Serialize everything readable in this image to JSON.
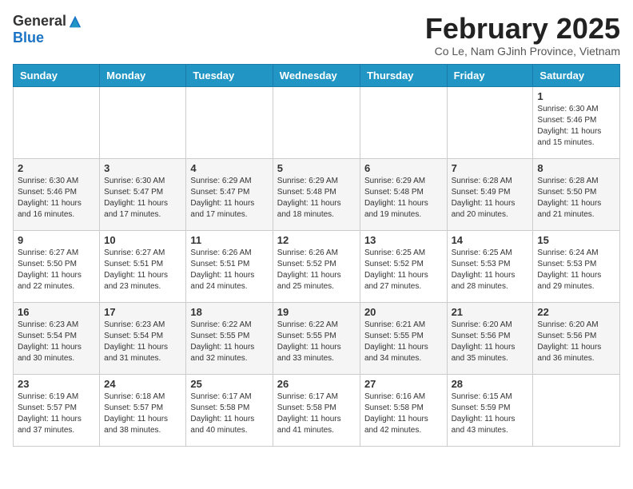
{
  "header": {
    "logo_general": "General",
    "logo_blue": "Blue",
    "month_title": "February 2025",
    "subtitle": "Co Le, Nam GJinh Province, Vietnam"
  },
  "days_of_week": [
    "Sunday",
    "Monday",
    "Tuesday",
    "Wednesday",
    "Thursday",
    "Friday",
    "Saturday"
  ],
  "weeks": [
    [
      {
        "day": "",
        "info": ""
      },
      {
        "day": "",
        "info": ""
      },
      {
        "day": "",
        "info": ""
      },
      {
        "day": "",
        "info": ""
      },
      {
        "day": "",
        "info": ""
      },
      {
        "day": "",
        "info": ""
      },
      {
        "day": "1",
        "info": "Sunrise: 6:30 AM\nSunset: 5:46 PM\nDaylight: 11 hours\nand 15 minutes."
      }
    ],
    [
      {
        "day": "2",
        "info": "Sunrise: 6:30 AM\nSunset: 5:46 PM\nDaylight: 11 hours\nand 16 minutes."
      },
      {
        "day": "3",
        "info": "Sunrise: 6:30 AM\nSunset: 5:47 PM\nDaylight: 11 hours\nand 17 minutes."
      },
      {
        "day": "4",
        "info": "Sunrise: 6:29 AM\nSunset: 5:47 PM\nDaylight: 11 hours\nand 17 minutes."
      },
      {
        "day": "5",
        "info": "Sunrise: 6:29 AM\nSunset: 5:48 PM\nDaylight: 11 hours\nand 18 minutes."
      },
      {
        "day": "6",
        "info": "Sunrise: 6:29 AM\nSunset: 5:48 PM\nDaylight: 11 hours\nand 19 minutes."
      },
      {
        "day": "7",
        "info": "Sunrise: 6:28 AM\nSunset: 5:49 PM\nDaylight: 11 hours\nand 20 minutes."
      },
      {
        "day": "8",
        "info": "Sunrise: 6:28 AM\nSunset: 5:50 PM\nDaylight: 11 hours\nand 21 minutes."
      }
    ],
    [
      {
        "day": "9",
        "info": "Sunrise: 6:27 AM\nSunset: 5:50 PM\nDaylight: 11 hours\nand 22 minutes."
      },
      {
        "day": "10",
        "info": "Sunrise: 6:27 AM\nSunset: 5:51 PM\nDaylight: 11 hours\nand 23 minutes."
      },
      {
        "day": "11",
        "info": "Sunrise: 6:26 AM\nSunset: 5:51 PM\nDaylight: 11 hours\nand 24 minutes."
      },
      {
        "day": "12",
        "info": "Sunrise: 6:26 AM\nSunset: 5:52 PM\nDaylight: 11 hours\nand 25 minutes."
      },
      {
        "day": "13",
        "info": "Sunrise: 6:25 AM\nSunset: 5:52 PM\nDaylight: 11 hours\nand 27 minutes."
      },
      {
        "day": "14",
        "info": "Sunrise: 6:25 AM\nSunset: 5:53 PM\nDaylight: 11 hours\nand 28 minutes."
      },
      {
        "day": "15",
        "info": "Sunrise: 6:24 AM\nSunset: 5:53 PM\nDaylight: 11 hours\nand 29 minutes."
      }
    ],
    [
      {
        "day": "16",
        "info": "Sunrise: 6:23 AM\nSunset: 5:54 PM\nDaylight: 11 hours\nand 30 minutes."
      },
      {
        "day": "17",
        "info": "Sunrise: 6:23 AM\nSunset: 5:54 PM\nDaylight: 11 hours\nand 31 minutes."
      },
      {
        "day": "18",
        "info": "Sunrise: 6:22 AM\nSunset: 5:55 PM\nDaylight: 11 hours\nand 32 minutes."
      },
      {
        "day": "19",
        "info": "Sunrise: 6:22 AM\nSunset: 5:55 PM\nDaylight: 11 hours\nand 33 minutes."
      },
      {
        "day": "20",
        "info": "Sunrise: 6:21 AM\nSunset: 5:55 PM\nDaylight: 11 hours\nand 34 minutes."
      },
      {
        "day": "21",
        "info": "Sunrise: 6:20 AM\nSunset: 5:56 PM\nDaylight: 11 hours\nand 35 minutes."
      },
      {
        "day": "22",
        "info": "Sunrise: 6:20 AM\nSunset: 5:56 PM\nDaylight: 11 hours\nand 36 minutes."
      }
    ],
    [
      {
        "day": "23",
        "info": "Sunrise: 6:19 AM\nSunset: 5:57 PM\nDaylight: 11 hours\nand 37 minutes."
      },
      {
        "day": "24",
        "info": "Sunrise: 6:18 AM\nSunset: 5:57 PM\nDaylight: 11 hours\nand 38 minutes."
      },
      {
        "day": "25",
        "info": "Sunrise: 6:17 AM\nSunset: 5:58 PM\nDaylight: 11 hours\nand 40 minutes."
      },
      {
        "day": "26",
        "info": "Sunrise: 6:17 AM\nSunset: 5:58 PM\nDaylight: 11 hours\nand 41 minutes."
      },
      {
        "day": "27",
        "info": "Sunrise: 6:16 AM\nSunset: 5:58 PM\nDaylight: 11 hours\nand 42 minutes."
      },
      {
        "day": "28",
        "info": "Sunrise: 6:15 AM\nSunset: 5:59 PM\nDaylight: 11 hours\nand 43 minutes."
      },
      {
        "day": "",
        "info": ""
      }
    ]
  ]
}
